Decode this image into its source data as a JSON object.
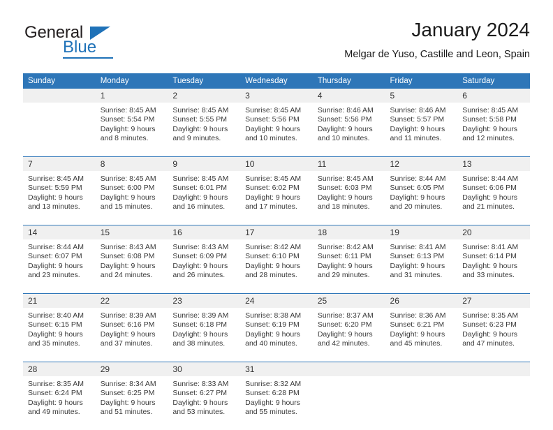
{
  "logo": {
    "word_top": "General",
    "word_bottom": "Blue",
    "accent_color": "#1f72b8"
  },
  "header": {
    "title": "January 2024",
    "subtitle": "Melgar de Yuso, Castille and Leon, Spain"
  },
  "theme": {
    "header_blue": "#2e76b8",
    "daynum_band": "#f0f0f0",
    "text": "#3a3a3a"
  },
  "calendar": {
    "weekday_headers": [
      "Sunday",
      "Monday",
      "Tuesday",
      "Wednesday",
      "Thursday",
      "Friday",
      "Saturday"
    ],
    "weeks": [
      {
        "numbers": [
          "",
          "1",
          "2",
          "3",
          "4",
          "5",
          "6"
        ],
        "details": [
          {
            "sunrise": "",
            "sunset": "",
            "daylight_a": "",
            "daylight_b": ""
          },
          {
            "sunrise": "Sunrise: 8:45 AM",
            "sunset": "Sunset: 5:54 PM",
            "daylight_a": "Daylight: 9 hours",
            "daylight_b": "and 8 minutes."
          },
          {
            "sunrise": "Sunrise: 8:45 AM",
            "sunset": "Sunset: 5:55 PM",
            "daylight_a": "Daylight: 9 hours",
            "daylight_b": "and 9 minutes."
          },
          {
            "sunrise": "Sunrise: 8:45 AM",
            "sunset": "Sunset: 5:56 PM",
            "daylight_a": "Daylight: 9 hours",
            "daylight_b": "and 10 minutes."
          },
          {
            "sunrise": "Sunrise: 8:46 AM",
            "sunset": "Sunset: 5:56 PM",
            "daylight_a": "Daylight: 9 hours",
            "daylight_b": "and 10 minutes."
          },
          {
            "sunrise": "Sunrise: 8:46 AM",
            "sunset": "Sunset: 5:57 PM",
            "daylight_a": "Daylight: 9 hours",
            "daylight_b": "and 11 minutes."
          },
          {
            "sunrise": "Sunrise: 8:45 AM",
            "sunset": "Sunset: 5:58 PM",
            "daylight_a": "Daylight: 9 hours",
            "daylight_b": "and 12 minutes."
          }
        ]
      },
      {
        "numbers": [
          "7",
          "8",
          "9",
          "10",
          "11",
          "12",
          "13"
        ],
        "details": [
          {
            "sunrise": "Sunrise: 8:45 AM",
            "sunset": "Sunset: 5:59 PM",
            "daylight_a": "Daylight: 9 hours",
            "daylight_b": "and 13 minutes."
          },
          {
            "sunrise": "Sunrise: 8:45 AM",
            "sunset": "Sunset: 6:00 PM",
            "daylight_a": "Daylight: 9 hours",
            "daylight_b": "and 15 minutes."
          },
          {
            "sunrise": "Sunrise: 8:45 AM",
            "sunset": "Sunset: 6:01 PM",
            "daylight_a": "Daylight: 9 hours",
            "daylight_b": "and 16 minutes."
          },
          {
            "sunrise": "Sunrise: 8:45 AM",
            "sunset": "Sunset: 6:02 PM",
            "daylight_a": "Daylight: 9 hours",
            "daylight_b": "and 17 minutes."
          },
          {
            "sunrise": "Sunrise: 8:45 AM",
            "sunset": "Sunset: 6:03 PM",
            "daylight_a": "Daylight: 9 hours",
            "daylight_b": "and 18 minutes."
          },
          {
            "sunrise": "Sunrise: 8:44 AM",
            "sunset": "Sunset: 6:05 PM",
            "daylight_a": "Daylight: 9 hours",
            "daylight_b": "and 20 minutes."
          },
          {
            "sunrise": "Sunrise: 8:44 AM",
            "sunset": "Sunset: 6:06 PM",
            "daylight_a": "Daylight: 9 hours",
            "daylight_b": "and 21 minutes."
          }
        ]
      },
      {
        "numbers": [
          "14",
          "15",
          "16",
          "17",
          "18",
          "19",
          "20"
        ],
        "details": [
          {
            "sunrise": "Sunrise: 8:44 AM",
            "sunset": "Sunset: 6:07 PM",
            "daylight_a": "Daylight: 9 hours",
            "daylight_b": "and 23 minutes."
          },
          {
            "sunrise": "Sunrise: 8:43 AM",
            "sunset": "Sunset: 6:08 PM",
            "daylight_a": "Daylight: 9 hours",
            "daylight_b": "and 24 minutes."
          },
          {
            "sunrise": "Sunrise: 8:43 AM",
            "sunset": "Sunset: 6:09 PM",
            "daylight_a": "Daylight: 9 hours",
            "daylight_b": "and 26 minutes."
          },
          {
            "sunrise": "Sunrise: 8:42 AM",
            "sunset": "Sunset: 6:10 PM",
            "daylight_a": "Daylight: 9 hours",
            "daylight_b": "and 28 minutes."
          },
          {
            "sunrise": "Sunrise: 8:42 AM",
            "sunset": "Sunset: 6:11 PM",
            "daylight_a": "Daylight: 9 hours",
            "daylight_b": "and 29 minutes."
          },
          {
            "sunrise": "Sunrise: 8:41 AM",
            "sunset": "Sunset: 6:13 PM",
            "daylight_a": "Daylight: 9 hours",
            "daylight_b": "and 31 minutes."
          },
          {
            "sunrise": "Sunrise: 8:41 AM",
            "sunset": "Sunset: 6:14 PM",
            "daylight_a": "Daylight: 9 hours",
            "daylight_b": "and 33 minutes."
          }
        ]
      },
      {
        "numbers": [
          "21",
          "22",
          "23",
          "24",
          "25",
          "26",
          "27"
        ],
        "details": [
          {
            "sunrise": "Sunrise: 8:40 AM",
            "sunset": "Sunset: 6:15 PM",
            "daylight_a": "Daylight: 9 hours",
            "daylight_b": "and 35 minutes."
          },
          {
            "sunrise": "Sunrise: 8:39 AM",
            "sunset": "Sunset: 6:16 PM",
            "daylight_a": "Daylight: 9 hours",
            "daylight_b": "and 37 minutes."
          },
          {
            "sunrise": "Sunrise: 8:39 AM",
            "sunset": "Sunset: 6:18 PM",
            "daylight_a": "Daylight: 9 hours",
            "daylight_b": "and 38 minutes."
          },
          {
            "sunrise": "Sunrise: 8:38 AM",
            "sunset": "Sunset: 6:19 PM",
            "daylight_a": "Daylight: 9 hours",
            "daylight_b": "and 40 minutes."
          },
          {
            "sunrise": "Sunrise: 8:37 AM",
            "sunset": "Sunset: 6:20 PM",
            "daylight_a": "Daylight: 9 hours",
            "daylight_b": "and 42 minutes."
          },
          {
            "sunrise": "Sunrise: 8:36 AM",
            "sunset": "Sunset: 6:21 PM",
            "daylight_a": "Daylight: 9 hours",
            "daylight_b": "and 45 minutes."
          },
          {
            "sunrise": "Sunrise: 8:35 AM",
            "sunset": "Sunset: 6:23 PM",
            "daylight_a": "Daylight: 9 hours",
            "daylight_b": "and 47 minutes."
          }
        ]
      },
      {
        "numbers": [
          "28",
          "29",
          "30",
          "31",
          "",
          "",
          ""
        ],
        "details": [
          {
            "sunrise": "Sunrise: 8:35 AM",
            "sunset": "Sunset: 6:24 PM",
            "daylight_a": "Daylight: 9 hours",
            "daylight_b": "and 49 minutes."
          },
          {
            "sunrise": "Sunrise: 8:34 AM",
            "sunset": "Sunset: 6:25 PM",
            "daylight_a": "Daylight: 9 hours",
            "daylight_b": "and 51 minutes."
          },
          {
            "sunrise": "Sunrise: 8:33 AM",
            "sunset": "Sunset: 6:27 PM",
            "daylight_a": "Daylight: 9 hours",
            "daylight_b": "and 53 minutes."
          },
          {
            "sunrise": "Sunrise: 8:32 AM",
            "sunset": "Sunset: 6:28 PM",
            "daylight_a": "Daylight: 9 hours",
            "daylight_b": "and 55 minutes."
          },
          {
            "sunrise": "",
            "sunset": "",
            "daylight_a": "",
            "daylight_b": ""
          },
          {
            "sunrise": "",
            "sunset": "",
            "daylight_a": "",
            "daylight_b": ""
          },
          {
            "sunrise": "",
            "sunset": "",
            "daylight_a": "",
            "daylight_b": ""
          }
        ]
      }
    ]
  }
}
